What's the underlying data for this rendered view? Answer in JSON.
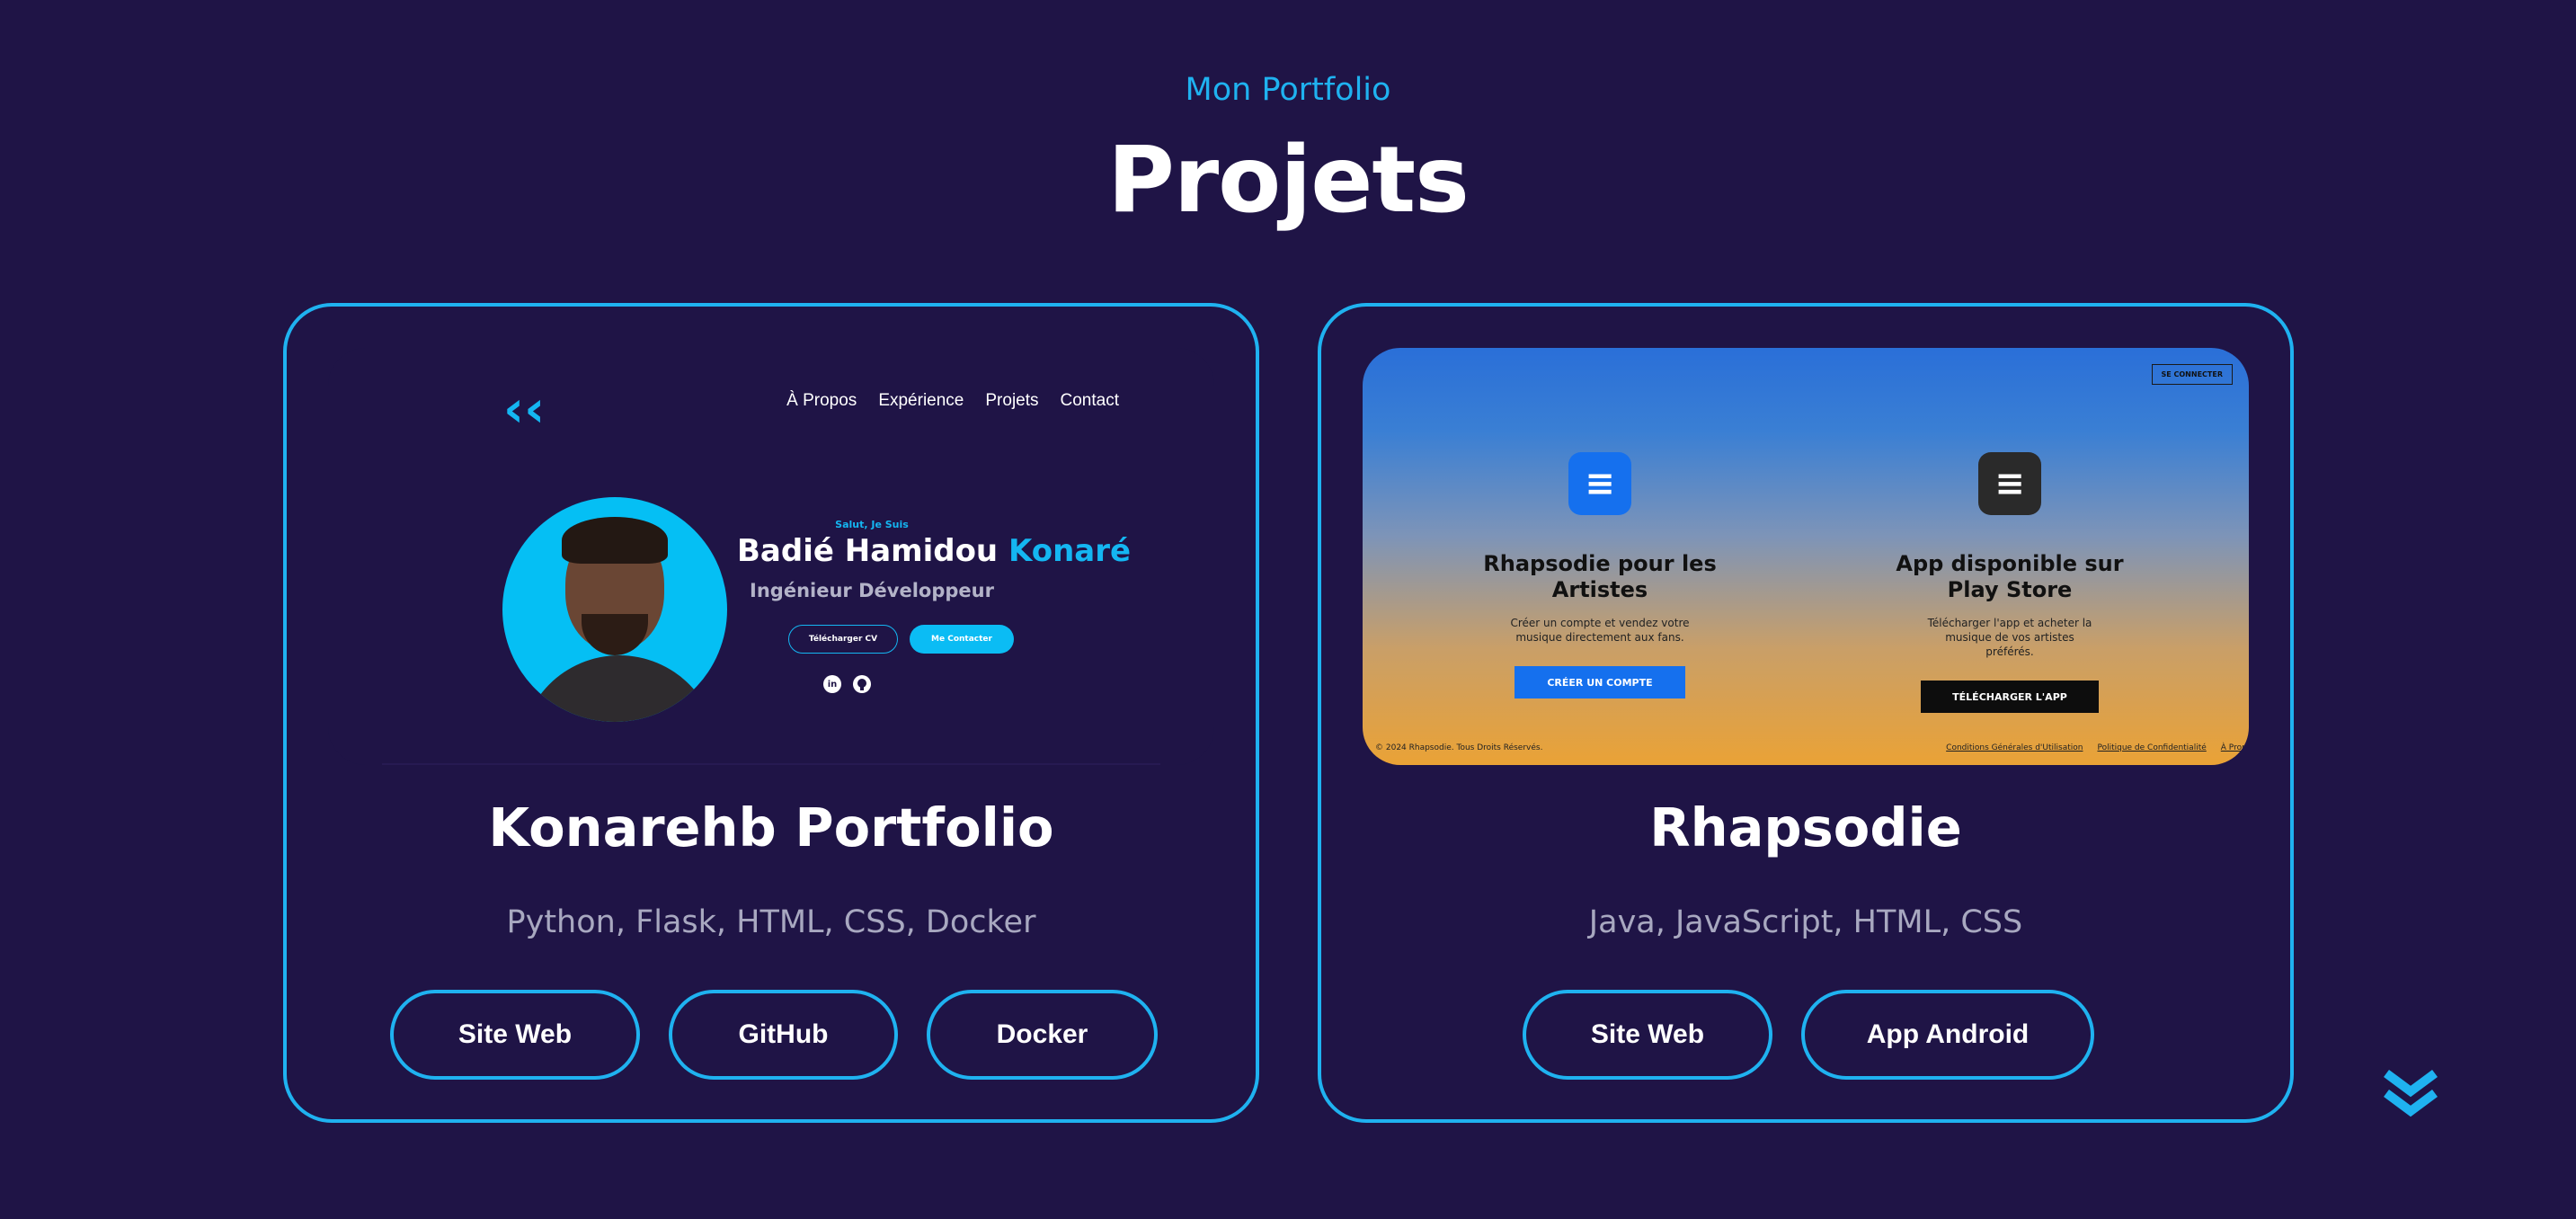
{
  "header": {
    "subtitle": "Mon Portfolio",
    "title": "Projets"
  },
  "projects": [
    {
      "title": "Konarehb Portfolio",
      "tech": "Python, Flask, HTML, CSS, Docker",
      "buttons": [
        "Site Web",
        "GitHub",
        "Docker"
      ],
      "preview": {
        "logo": "‹‹",
        "nav": [
          "À Propos",
          "Expérience",
          "Projets",
          "Contact"
        ],
        "greeting": "Salut, Je Suis",
        "name_first": "Badié Hamidou ",
        "name_last": "Konaré",
        "role": "Ingénieur Développeur",
        "cv_button": "Télécharger CV",
        "contact_button": "Me Contacter",
        "social_icons": [
          "linkedin-icon",
          "github-icon"
        ]
      }
    },
    {
      "title": "Rhapsodie",
      "tech": "Java, JavaScript, HTML, CSS",
      "buttons": [
        "Site Web",
        "App Android"
      ],
      "preview": {
        "connect": "SE CONNECTER",
        "left_title": "Rhapsodie pour les Artistes",
        "left_desc": "Créer un compte et vendez votre musique directement aux fans.",
        "left_button": "CRÉER UN COMPTE",
        "right_title": "App disponible sur Play Store",
        "right_desc": "Télécharger l'app et acheter la musique de vos artistes préférés.",
        "right_button": "TÉLÉCHARGER L'APP",
        "footer_copyright": "© 2024 Rhapsodie. Tous Droits Réservés.",
        "footer_links": [
          "Conditions Générales d'Utilisation",
          "Politique de Confidentialité",
          "À Propos"
        ]
      }
    }
  ],
  "scroll": {
    "icon": "double-chevron-down-icon"
  },
  "colors": {
    "background": "#1f1446",
    "accent": "#1fb2f0",
    "muted_text": "#a8a8c0"
  }
}
